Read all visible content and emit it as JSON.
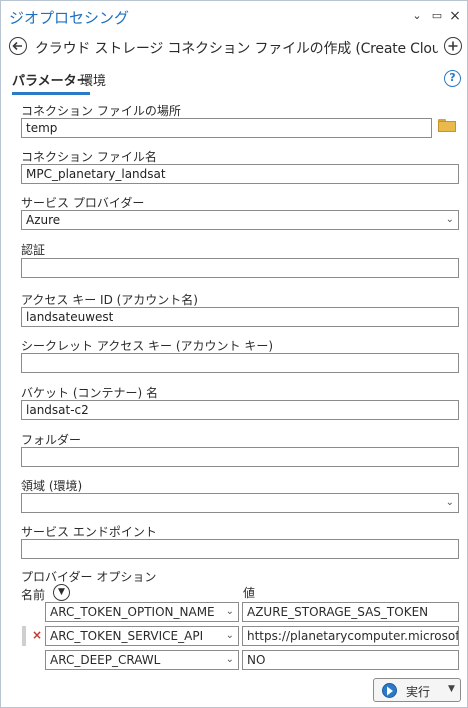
{
  "app_title": "ジオプロセシング",
  "tool_title": "クラウド ストレージ コネクション ファイルの作成 (Create Cloud Stora…",
  "tabs": {
    "parameters": "パラメーター",
    "environment": "環境"
  },
  "fields": {
    "location": {
      "label": "コネクション ファイルの場所",
      "value": "temp"
    },
    "name": {
      "label": "コネクション ファイル名",
      "value": "MPC_planetary_landsat"
    },
    "provider": {
      "label": "サービス プロバイダー",
      "value": "Azure"
    },
    "auth": {
      "label": "認証",
      "value": ""
    },
    "access_key": {
      "label": "アクセス キー ID (アカウント名)",
      "value": "landsateuwest"
    },
    "secret_key": {
      "label": "シークレット アクセス キー (アカウント キー)",
      "value": ""
    },
    "bucket": {
      "label": "バケット (コンテナー) 名",
      "value": "landsat-c2"
    },
    "folder": {
      "label": "フォルダー",
      "value": ""
    },
    "region": {
      "label": "領域 (環境)",
      "value": ""
    },
    "endpoint": {
      "label": "サービス エンドポイント",
      "value": ""
    }
  },
  "provider_options": {
    "label": "プロバイダー オプション",
    "col_name": "名前",
    "col_value": "値",
    "rows": [
      {
        "name": "ARC_TOKEN_OPTION_NAME",
        "value": "AZURE_STORAGE_SAS_TOKEN"
      },
      {
        "name": "ARC_TOKEN_SERVICE_API",
        "value": "https://planetarycomputer.microsoft.co"
      },
      {
        "name": "ARC_DEEP_CRAWL",
        "value": "NO"
      }
    ]
  },
  "run_label": "実行",
  "icons": {
    "back": "back-arrow-icon",
    "add": "add-icon",
    "help": "help-icon",
    "folder": "folder-icon",
    "run": "play-icon"
  },
  "colors": {
    "accent": "#2a7ac8",
    "title": "#1f6fbf",
    "remove": "#c0392b",
    "folder": "#e9b94a"
  }
}
